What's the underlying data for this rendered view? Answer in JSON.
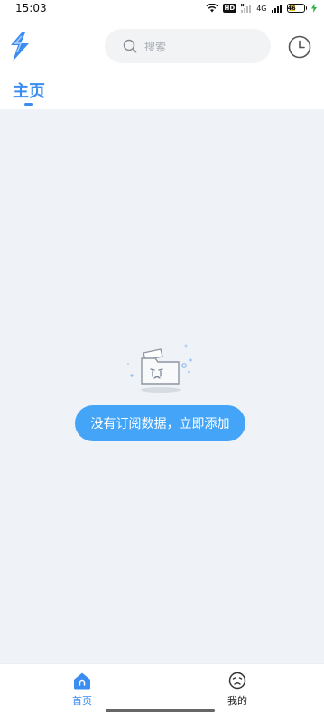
{
  "status_bar": {
    "time": "15:03",
    "hd_badge": "HD",
    "network_label": "4G",
    "battery_level": "46",
    "battery_fraction": 0.46
  },
  "header": {
    "logo_icon": "lightning-bolt-icon",
    "search_placeholder": "搜索",
    "history_icon": "clock-icon"
  },
  "tabs": [
    {
      "label": "主页",
      "active": true
    }
  ],
  "empty_state": {
    "illustration": "empty-folder-icon",
    "button_label": "没有订阅数据，立即添加"
  },
  "bottom_nav": [
    {
      "label": "首页",
      "icon": "home-icon",
      "active": true
    },
    {
      "label": "我的",
      "icon": "face-icon",
      "active": false
    }
  ],
  "colors": {
    "accent": "#3b8df1",
    "button": "#44a4f7",
    "content_bg": "#eff2f7",
    "search_bg": "#f2f3f5"
  }
}
